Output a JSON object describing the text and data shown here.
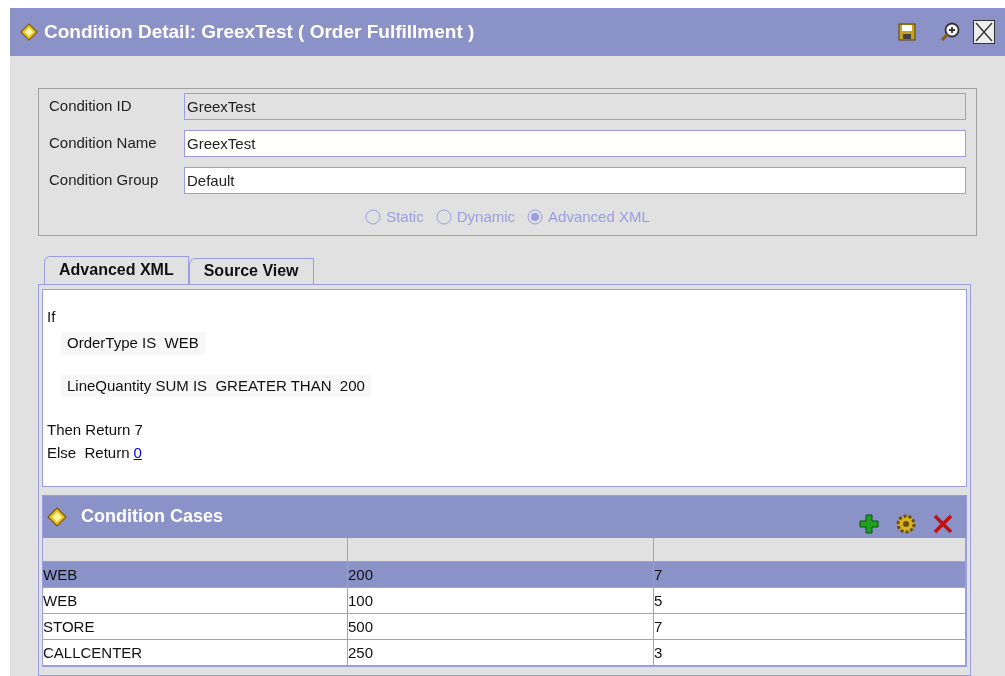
{
  "window": {
    "title": "Condition Detail: GreexTest ( Order Fulfillment )"
  },
  "form": {
    "fields": [
      {
        "label": "Condition ID",
        "value": "GreexTest",
        "disabled": true
      },
      {
        "label": "Condition Name",
        "value": "GreexTest",
        "disabled": false
      },
      {
        "label": "Condition Group",
        "value": "Default",
        "disabled": false
      }
    ],
    "radios": [
      {
        "label": "Static",
        "selected": false,
        "disabled": true
      },
      {
        "label": "Dynamic",
        "selected": false,
        "disabled": true
      },
      {
        "label": "Advanced XML",
        "selected": true,
        "disabled": true
      }
    ]
  },
  "tabs": [
    {
      "label": "Advanced XML",
      "selected": true
    },
    {
      "label": "Source View",
      "selected": false
    }
  ],
  "editor": {
    "if_label": "If",
    "conditions": [
      "OrderType IS  WEB",
      "LineQuantity SUM IS  GREATER THAN  200"
    ],
    "then_text": "Then Return 7",
    "else_text": "Else  Return",
    "else_link": "0"
  },
  "cases": {
    "title": "Condition Cases",
    "columns": [
      "",
      "",
      ""
    ],
    "rows": [
      {
        "cells": [
          "WEB",
          "200",
          "7"
        ],
        "selected": true
      },
      {
        "cells": [
          "WEB",
          "100",
          "5"
        ],
        "selected": false
      },
      {
        "cells": [
          "STORE",
          "500",
          "7"
        ],
        "selected": false
      },
      {
        "cells": [
          "CALLCENTER",
          "250",
          "3"
        ],
        "selected": false
      }
    ]
  }
}
